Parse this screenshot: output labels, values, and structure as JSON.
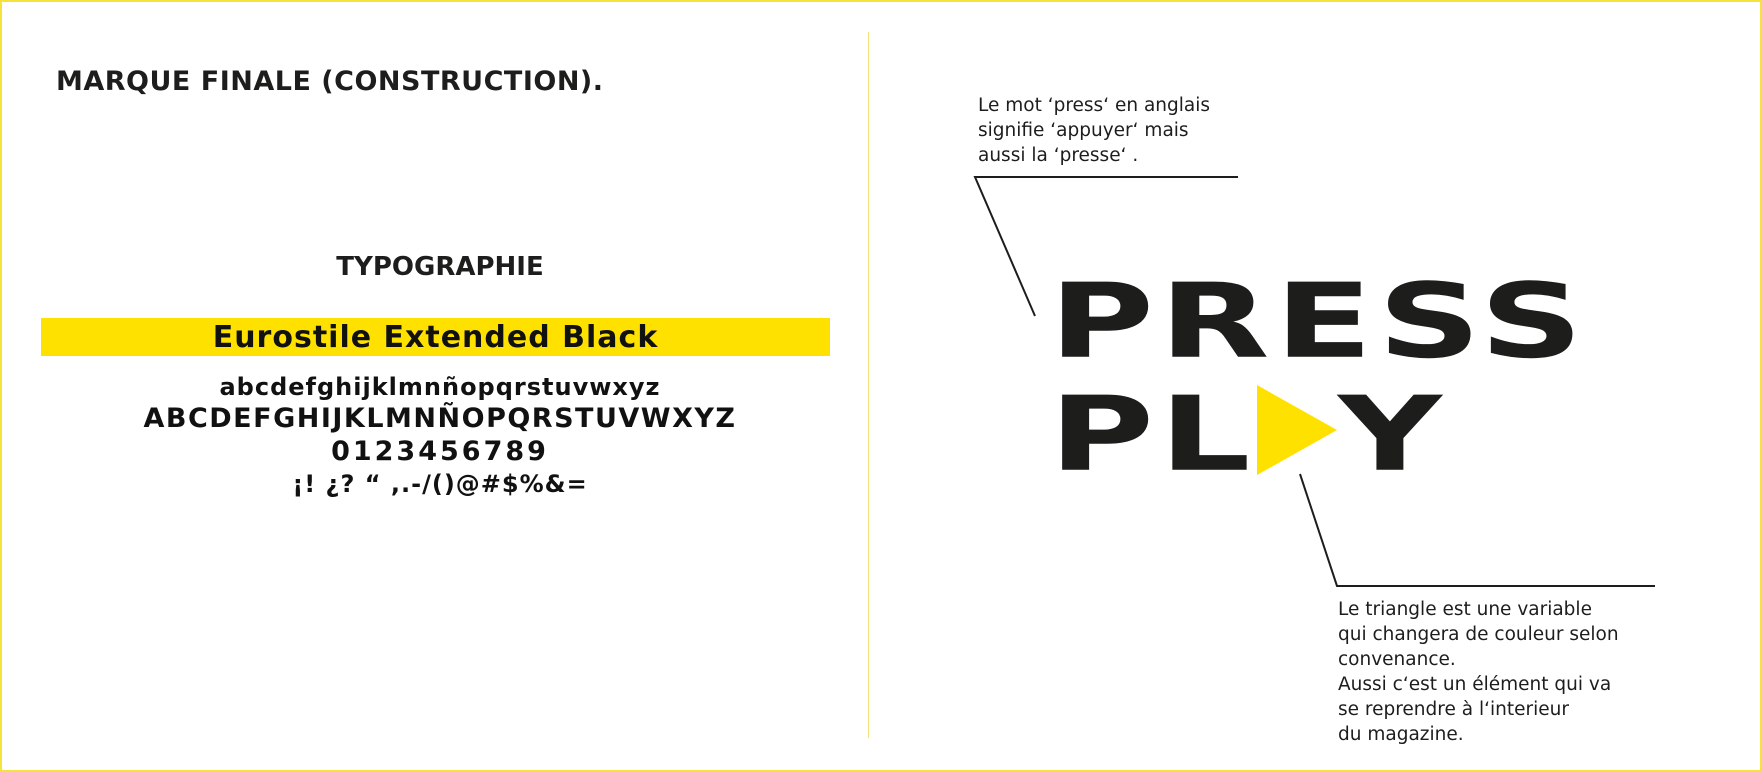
{
  "title": "MARQUE FINALE (CONSTRUCTION).",
  "typography": {
    "heading": "TYPOGRAPHIE",
    "font_name": "Eurostile Extended Black",
    "lowercase": "abcdefghijklmnñopqrstuvwxyz",
    "uppercase": "ABCDEFGHIJKLMNÑOPQRSTUVWXYZ",
    "digits": "0123456789",
    "symbols": "¡! ¿? “ ,.-/()@#$%&="
  },
  "logo": {
    "line1": "PRESS",
    "line2_start": "PL",
    "line2_end": "Y",
    "triangle_icon": "play-triangle-icon",
    "text_color": "#1d1d1b",
    "triangle_color": "#ffe100"
  },
  "annotations": {
    "top": [
      "Le mot ‘press‘ en anglais",
      "signifie  ‘appuyer‘ mais",
      "aussi la ‘presse‘ ."
    ],
    "bottom": [
      "Le triangle est une variable",
      "qui changera de couleur selon",
      "convenance.",
      "Aussi c‘est un élément qui va",
      "se  reprendre  à l‘interieur",
      "du magazine."
    ]
  },
  "colors": {
    "accent_yellow": "#ffe100",
    "frame": "#f5e23a",
    "text": "#1d1d1b"
  }
}
